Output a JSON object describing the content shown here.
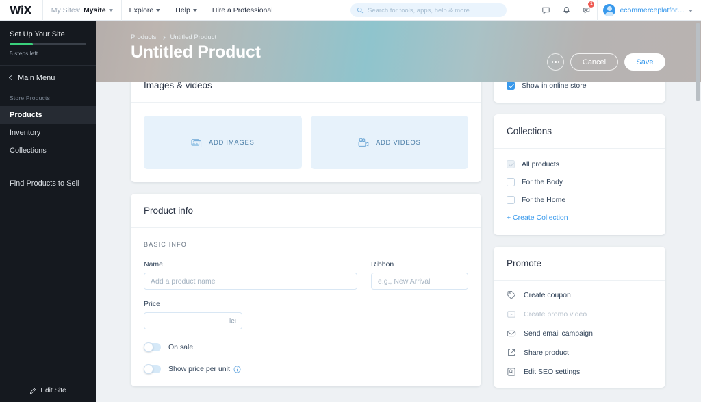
{
  "topbar": {
    "logo": "WiX",
    "my_sites_label": "My Sites:",
    "my_sites_value": "Mysite",
    "nav": [
      {
        "label": "Explore",
        "has_caret": true
      },
      {
        "label": "Help",
        "has_caret": true
      },
      {
        "label": "Hire a Professional",
        "has_caret": false
      }
    ],
    "search_placeholder": "Search for tools, apps, help & more...",
    "search_value": "",
    "icons": [
      {
        "name": "chat-icon"
      },
      {
        "name": "bell-icon"
      },
      {
        "name": "feedback-icon",
        "badge": "1"
      }
    ],
    "account_name": "ecommerceplatfor…"
  },
  "sidebar": {
    "setup_title": "Set Up Your Site",
    "progress_percent": 30,
    "progress_color": "#3ad17c",
    "steps_left": "5 steps left",
    "main_menu": "Main Menu",
    "group_label": "Store Products",
    "items": [
      {
        "label": "Products",
        "active": true
      },
      {
        "label": "Inventory",
        "active": false
      },
      {
        "label": "Collections",
        "active": false
      }
    ],
    "find_products": "Find Products to Sell",
    "edit_site": "Edit Site"
  },
  "hero": {
    "breadcrumb_parent": "Products",
    "breadcrumb_current": "Untitled Product",
    "title": "Untitled Product",
    "cancel_label": "Cancel",
    "save_label": "Save",
    "save_color": "#3899ec"
  },
  "media_card": {
    "title": "Images & videos",
    "add_images_label": "ADD IMAGES",
    "add_videos_label": "ADD VIDEOS",
    "dropzone_bg": "#e7f2fb"
  },
  "product_info": {
    "title": "Product info",
    "section_label": "BASIC INFO",
    "name_label": "Name",
    "name_placeholder": "Add a product name",
    "name_value": "",
    "ribbon_label": "Ribbon",
    "ribbon_placeholder": "e.g., New Arrival",
    "ribbon_value": "",
    "price_label": "Price",
    "price_value": "",
    "price_currency": "lei",
    "toggles": [
      {
        "label": "On sale",
        "on": false,
        "info": false
      },
      {
        "label": "Show price per unit",
        "on": false,
        "info": true
      }
    ]
  },
  "show_in_store": {
    "label": "Show in online store",
    "checked": true,
    "accent": "#3899ec"
  },
  "collections": {
    "title": "Collections",
    "items": [
      {
        "label": "All products",
        "checked": true,
        "disabled": true
      },
      {
        "label": "For the Body",
        "checked": false,
        "disabled": false
      },
      {
        "label": "For the Home",
        "checked": false,
        "disabled": false
      }
    ],
    "create_link": "+ Create Collection"
  },
  "promote": {
    "title": "Promote",
    "items": [
      {
        "label": "Create coupon",
        "icon": "coupon-icon",
        "disabled": false
      },
      {
        "label": "Create promo video",
        "icon": "video-play-icon",
        "disabled": true
      },
      {
        "label": "Send email campaign",
        "icon": "envelope-icon",
        "disabled": false
      },
      {
        "label": "Share product",
        "icon": "share-icon",
        "disabled": false
      },
      {
        "label": "Edit SEO settings",
        "icon": "seo-icon",
        "disabled": false
      }
    ]
  }
}
